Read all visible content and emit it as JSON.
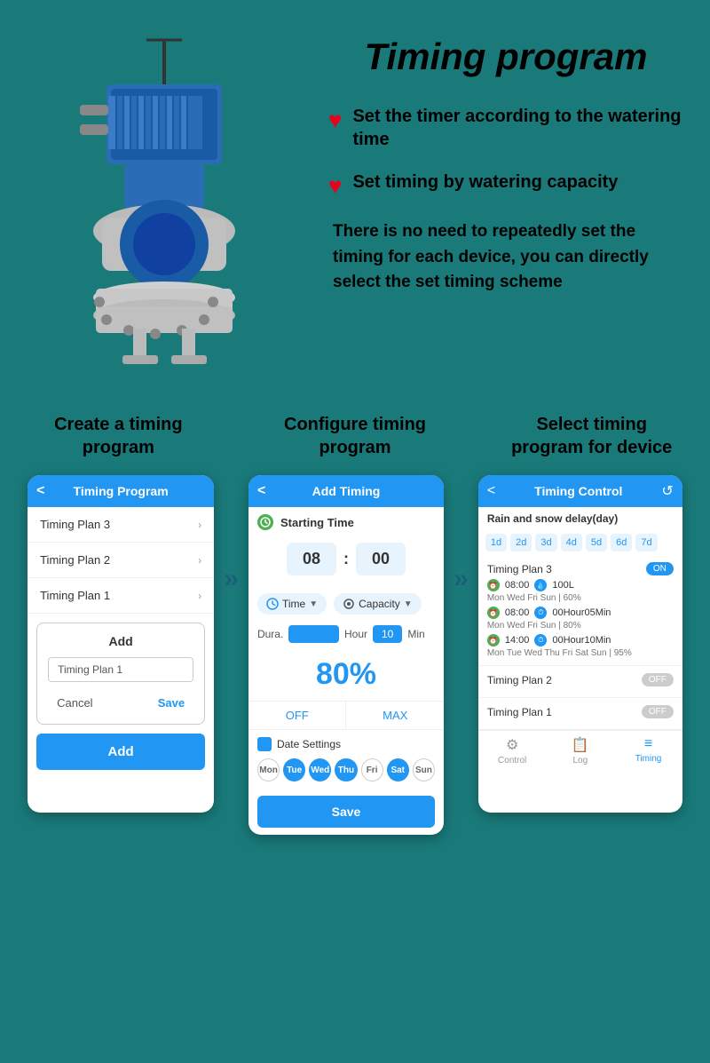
{
  "page": {
    "title": "Timing program",
    "bg_color": "#1a7a7a"
  },
  "hero": {
    "bullet1": "Set the timer according to the watering time",
    "bullet2": "Set timing by watering capacity",
    "description": "There is no need to repeatedly set the timing for each device, you can directly select the set timing scheme"
  },
  "steps": {
    "step1_title": "Create a timing program",
    "step2_title": "Configure timing program",
    "step3_title": "Select timing program for device"
  },
  "phone1": {
    "header": "Timing Program",
    "item1": "Timing Plan 3",
    "item2": "Timing Plan 2",
    "item3": "Timing Plan 1",
    "dialog_title": "Add",
    "dialog_input": "Timing Plan 1",
    "btn_cancel": "Cancel",
    "btn_save": "Save",
    "bottom_btn": "Add"
  },
  "phone2": {
    "header": "Add Timing",
    "starting_time_label": "Starting Time",
    "hour": "08",
    "minute": "00",
    "time_label": "Time",
    "capacity_label": "Capacity",
    "dura_label": "Dura.",
    "hour_label": "Hour",
    "min_val": "10",
    "min_label": "Min",
    "percent": "80%",
    "off_label": "OFF",
    "max_label": "MAX",
    "date_label": "Date Settings",
    "days": [
      "Mon",
      "Tue",
      "Wed",
      "Thu",
      "Fri",
      "Sat",
      "Sun"
    ],
    "active_days": [
      1,
      2,
      3,
      4,
      6
    ],
    "save_btn": "Save"
  },
  "phone3": {
    "header": "Timing Control",
    "rain_delay": "Rain and snow delay(day)",
    "day_buttons": [
      "1d",
      "2d",
      "3d",
      "4d",
      "5d",
      "6d",
      "7d"
    ],
    "plan3_name": "Timing Plan 3",
    "plan3_toggle": "ON",
    "plan3_item1_time": "08:00",
    "plan3_item1_cap": "100L",
    "plan3_item1_days": "Mon Wed Fri Sun | 60%",
    "plan3_item2_time": "08:00",
    "plan3_item2_dur": "00Hour05Min",
    "plan3_item2_days": "Mon Wed Fri Sun | 80%",
    "plan3_item3_time": "14:00",
    "plan3_item3_dur": "00Hour10Min",
    "plan3_item3_days": "Mon Tue Wed Thu Fri Sat Sun | 95%",
    "plan2_name": "Timing Plan 2",
    "plan2_toggle": "OFF",
    "plan1_name": "Timing Plan 1",
    "plan1_toggle": "OFF",
    "nav_control": "Control",
    "nav_log": "Log",
    "nav_timing": "Timing"
  }
}
